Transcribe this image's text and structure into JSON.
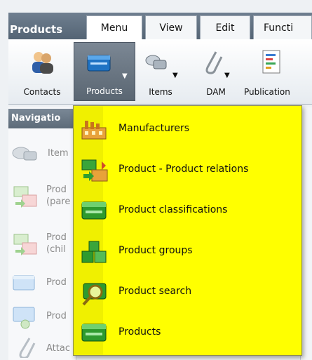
{
  "app": {
    "title": "Products"
  },
  "tabs": [
    {
      "label": "Menu",
      "active": true
    },
    {
      "label": "View",
      "active": false
    },
    {
      "label": "Edit",
      "active": false
    },
    {
      "label": "Functi",
      "active": false
    }
  ],
  "toolbar": {
    "items": [
      {
        "label": "Contacts",
        "icon": "contacts-icon"
      },
      {
        "label": "Products",
        "icon": "products-icon",
        "selected": true
      },
      {
        "label": "Items",
        "icon": "items-icon"
      },
      {
        "label": "DAM",
        "icon": "paperclip-icon"
      },
      {
        "label": "Publication",
        "icon": "publication-icon"
      }
    ]
  },
  "navigation": {
    "header": "Navigatio",
    "items": [
      {
        "label": "Item",
        "icon": "items-icon"
      },
      {
        "label": "Prod\n(pare",
        "icon": "product-relation-icon"
      },
      {
        "label": "Prod\n(chil",
        "icon": "product-relation-icon"
      },
      {
        "label": "Prod",
        "icon": "product-icon"
      },
      {
        "label": "Prod",
        "icon": "product-gear-icon"
      },
      {
        "label": "Attac",
        "icon": "paperclip-icon"
      }
    ]
  },
  "dropdown": {
    "background": "#ffff00",
    "items": [
      {
        "label": "Manufacturers",
        "icon": "factory-icon"
      },
      {
        "label": "Product - Product relations",
        "icon": "product-relations-icon"
      },
      {
        "label": "Product classifications",
        "icon": "product-box-icon"
      },
      {
        "label": "Product groups",
        "icon": "cubes-icon"
      },
      {
        "label": "Product search",
        "icon": "magnifier-icon"
      },
      {
        "label": "Products",
        "icon": "product-box-icon"
      }
    ]
  }
}
